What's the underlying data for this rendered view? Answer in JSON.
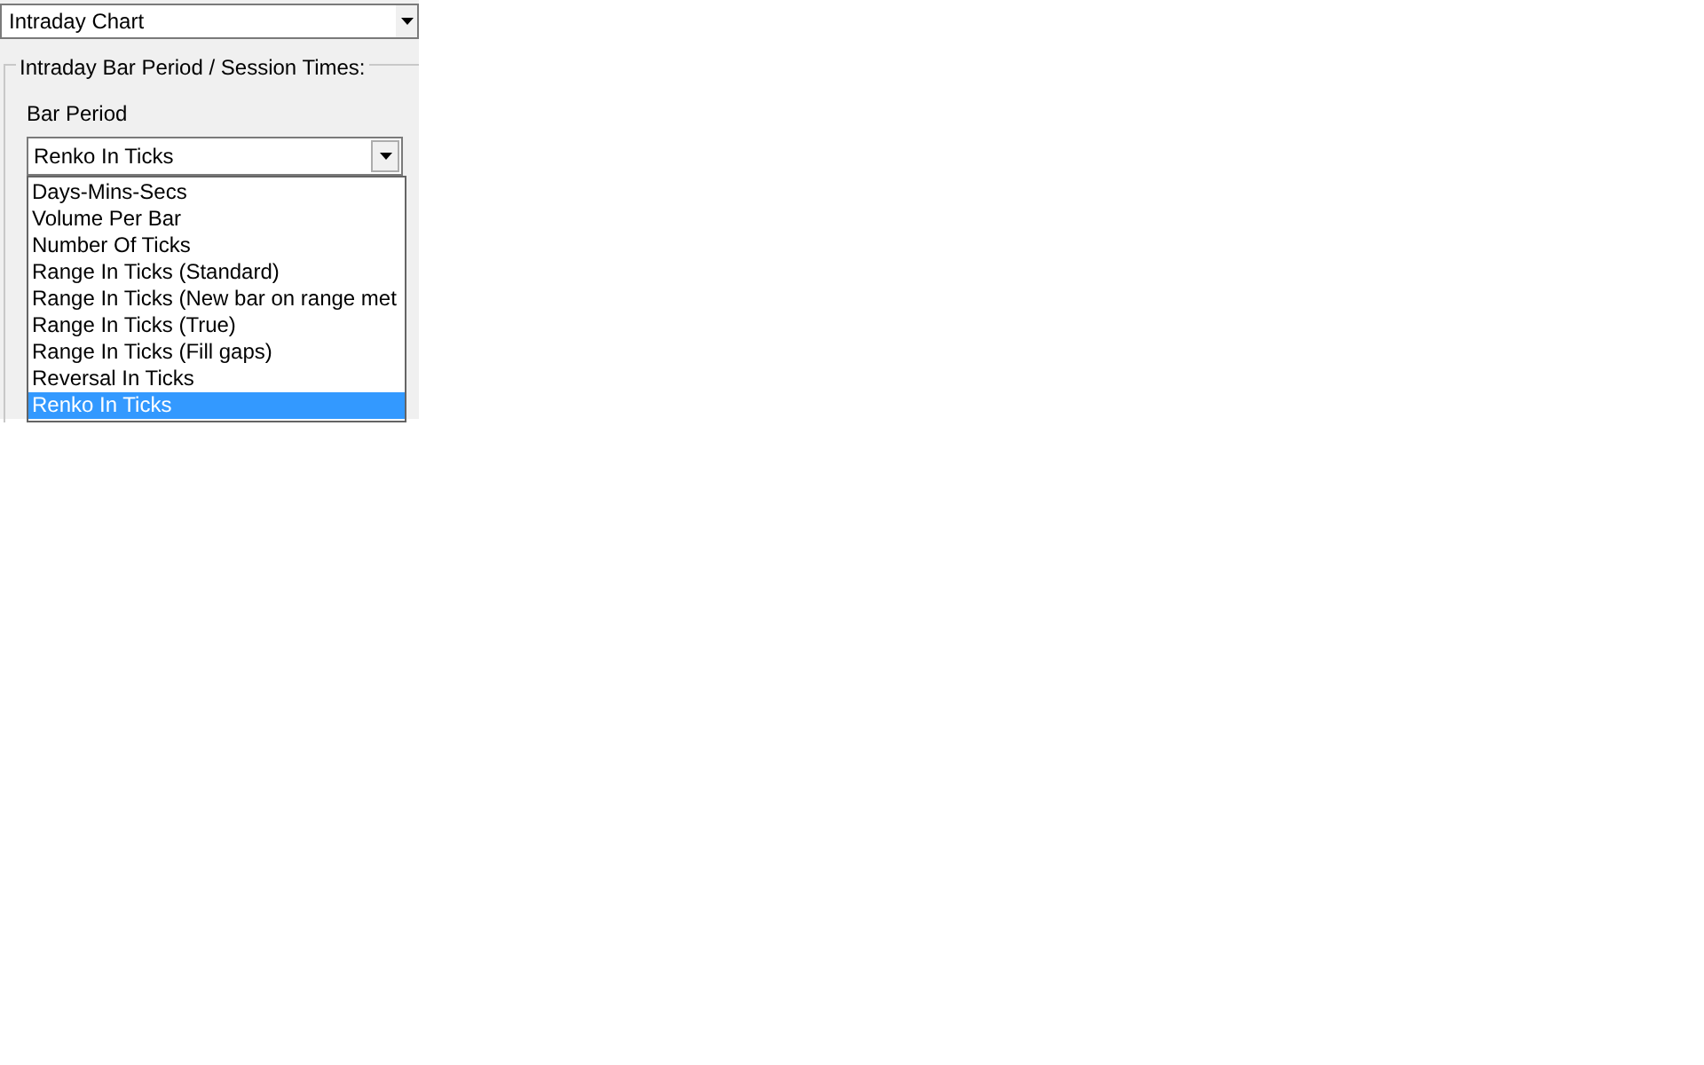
{
  "chart_type": {
    "value": "Intraday Chart"
  },
  "group": {
    "title": "Intraday Bar Period / Session Times:",
    "bar_period": {
      "label": "Bar Period",
      "value": "Renko In Ticks",
      "options": [
        {
          "label": "Days-Mins-Secs",
          "selected": false
        },
        {
          "label": "Volume Per Bar",
          "selected": false
        },
        {
          "label": "Number Of Ticks",
          "selected": false
        },
        {
          "label": "Range In Ticks (Standard)",
          "selected": false
        },
        {
          "label": "Range In Ticks (New bar on range met",
          "selected": false
        },
        {
          "label": "Range In Ticks (True)",
          "selected": false
        },
        {
          "label": "Range In Ticks (Fill gaps)",
          "selected": false
        },
        {
          "label": "Reversal In Ticks",
          "selected": false
        },
        {
          "label": "Renko In Ticks",
          "selected": true
        }
      ]
    }
  }
}
